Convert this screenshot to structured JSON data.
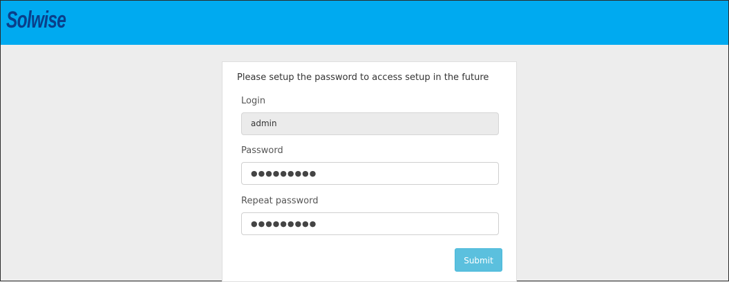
{
  "header": {
    "logo_text": "Solwise",
    "background_color": "#00aaf0",
    "logo_color": "#0a3f8a"
  },
  "form": {
    "intro": "Please setup the password to access setup in the future",
    "login_label": "Login",
    "login_value": "admin",
    "password_label": "Password",
    "password_value": "●●●●●●●●●",
    "repeat_label": "Repeat password",
    "repeat_value": "●●●●●●●●●",
    "submit_label": "Submit",
    "submit_color": "#5bc0de"
  }
}
